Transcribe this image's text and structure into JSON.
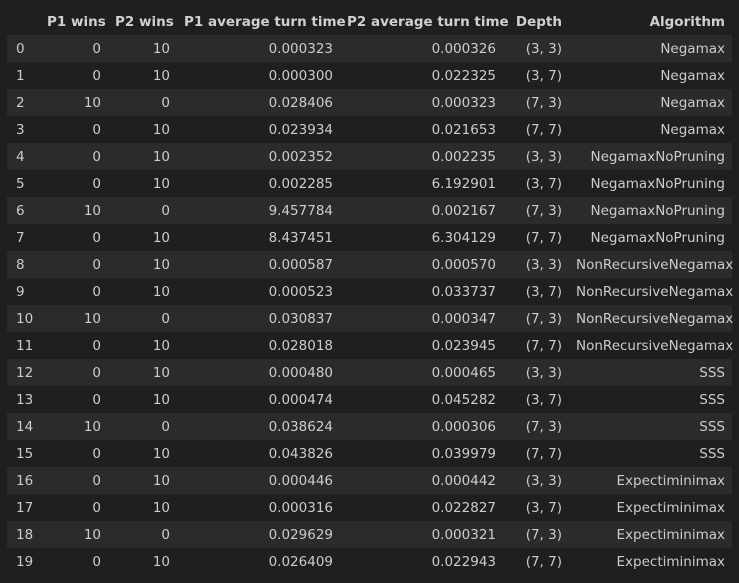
{
  "table": {
    "columns": [
      "",
      "P1 wins",
      "P2 wins",
      "P1 average turn time",
      "P2 average turn time",
      "Depth",
      "Algorithm"
    ],
    "rows": [
      [
        "0",
        "0",
        "10",
        "0.000323",
        "0.000326",
        "(3, 3)",
        "Negamax"
      ],
      [
        "1",
        "0",
        "10",
        "0.000300",
        "0.022325",
        "(3, 7)",
        "Negamax"
      ],
      [
        "2",
        "10",
        "0",
        "0.028406",
        "0.000323",
        "(7, 3)",
        "Negamax"
      ],
      [
        "3",
        "0",
        "10",
        "0.023934",
        "0.021653",
        "(7, 7)",
        "Negamax"
      ],
      [
        "4",
        "0",
        "10",
        "0.002352",
        "0.002235",
        "(3, 3)",
        "NegamaxNoPruning"
      ],
      [
        "5",
        "0",
        "10",
        "0.002285",
        "6.192901",
        "(3, 7)",
        "NegamaxNoPruning"
      ],
      [
        "6",
        "10",
        "0",
        "9.457784",
        "0.002167",
        "(7, 3)",
        "NegamaxNoPruning"
      ],
      [
        "7",
        "0",
        "10",
        "8.437451",
        "6.304129",
        "(7, 7)",
        "NegamaxNoPruning"
      ],
      [
        "8",
        "0",
        "10",
        "0.000587",
        "0.000570",
        "(3, 3)",
        "NonRecursiveNegamax"
      ],
      [
        "9",
        "0",
        "10",
        "0.000523",
        "0.033737",
        "(3, 7)",
        "NonRecursiveNegamax"
      ],
      [
        "10",
        "10",
        "0",
        "0.030837",
        "0.000347",
        "(7, 3)",
        "NonRecursiveNegamax"
      ],
      [
        "11",
        "0",
        "10",
        "0.028018",
        "0.023945",
        "(7, 7)",
        "NonRecursiveNegamax"
      ],
      [
        "12",
        "0",
        "10",
        "0.000480",
        "0.000465",
        "(3, 3)",
        "SSS"
      ],
      [
        "13",
        "0",
        "10",
        "0.000474",
        "0.045282",
        "(3, 7)",
        "SSS"
      ],
      [
        "14",
        "10",
        "0",
        "0.038624",
        "0.000306",
        "(7, 3)",
        "SSS"
      ],
      [
        "15",
        "0",
        "10",
        "0.043826",
        "0.039979",
        "(7, 7)",
        "SSS"
      ],
      [
        "16",
        "0",
        "10",
        "0.000446",
        "0.000442",
        "(3, 3)",
        "Expectiminimax"
      ],
      [
        "17",
        "0",
        "10",
        "0.000316",
        "0.022827",
        "(3, 7)",
        "Expectiminimax"
      ],
      [
        "18",
        "10",
        "0",
        "0.029629",
        "0.000321",
        "(7, 3)",
        "Expectiminimax"
      ],
      [
        "19",
        "0",
        "10",
        "0.026409",
        "0.022943",
        "(7, 7)",
        "Expectiminimax"
      ]
    ]
  },
  "colors": {
    "background": "#1f1f1f",
    "row_stripe": "#2b2b2b",
    "text": "#cccccc"
  }
}
